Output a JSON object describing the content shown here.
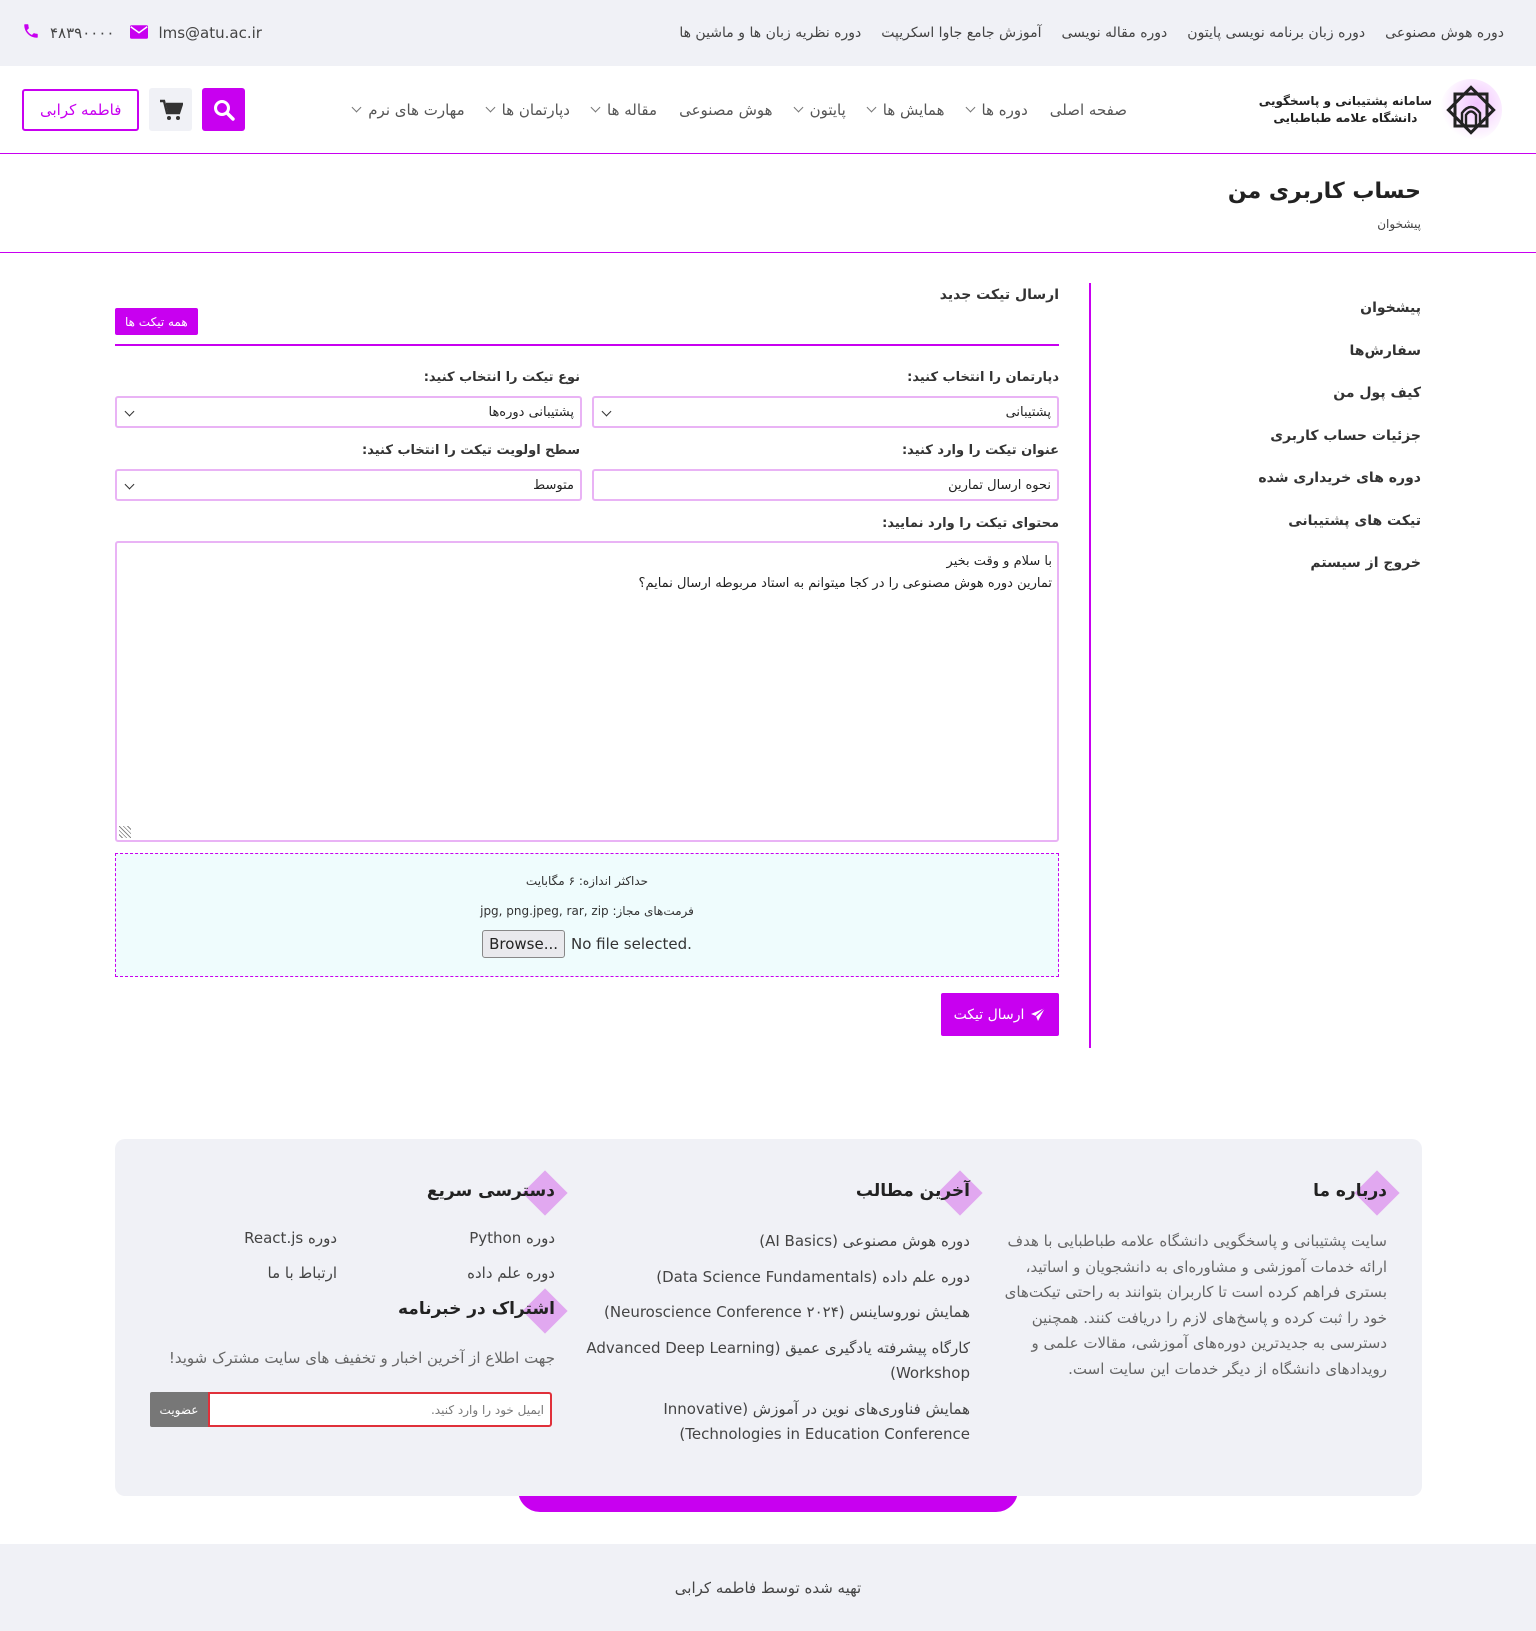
{
  "topbar": {
    "links": [
      "دوره هوش مصنوعی",
      "دوره زبان برنامه نویسی پایتون",
      "دوره مقاله نویسی",
      "آموزش جامع جاوا اسکریپت",
      "دوره نظریه زبان ها و ماشین ها"
    ],
    "email": "lms@atu.ac.ir",
    "phone": "۴۸۳۹۰۰۰۰"
  },
  "brand": {
    "line1": "سامانه پشتیبانی و پاسخگویی",
    "line2": "دانشگاه علامه طباطبایی"
  },
  "nav": [
    {
      "label": "صفحه اصلی",
      "dropdown": false
    },
    {
      "label": "دوره ها",
      "dropdown": true
    },
    {
      "label": "همایش ها",
      "dropdown": true
    },
    {
      "label": "پایتون",
      "dropdown": true
    },
    {
      "label": "هوش مصنوعی",
      "dropdown": false
    },
    {
      "label": "مقاله ها",
      "dropdown": true
    },
    {
      "label": "دپارتمان ها",
      "dropdown": true
    },
    {
      "label": "مهارت های نرم",
      "dropdown": true
    }
  ],
  "header": {
    "user_label": "فاطمه کرابی"
  },
  "page": {
    "title": "حساب کاربری من",
    "breadcrumb": "پیشخوان"
  },
  "sidebar": [
    "پیشخوان",
    "سفارش‌ها",
    "کیف پول من",
    "جزئیات حساب کاربری",
    "دوره های خریداری شده",
    "تیکت های پشتیبانی",
    "خروج از سیستم"
  ],
  "form": {
    "title": "ارسال تیکت جدید",
    "all_tickets": "همه تیکت ها",
    "department_label": "دپارتمان را انتخاب کنید:",
    "department_value": "پشتیبانی",
    "type_label": "نوع تیکت را انتخاب کنید:",
    "type_value": "پشتیبانی دوره‌ها",
    "subject_label": "عنوان تیکت را وارد کنید:",
    "subject_value": "نحوه ارسال تمارین",
    "priority_label": "سطح اولویت تیکت را انتخاب کنید:",
    "priority_value": "متوسط",
    "content_label": "محتوای تیکت را وارد نمایید:",
    "content_line1": "با سلام و وقت بخیر",
    "content_line2": "تمارین دوره هوش مصنوعی را در کجا میتوانم به استاد مربوطه ارسال نمایم؟",
    "max_size": "حداکثر اندازه: ۶ مگابایت",
    "formats": "فرمت‌های مجاز: jpg, png.jpeg, rar, zip",
    "browse": "Browse...",
    "no_file": "No file selected.",
    "send": "ارسال تیکت"
  },
  "footer": {
    "about_title": "درباره ما",
    "about_text": "سایت پشتیبانی و پاسخگویی دانشگاه علامه طباطبایی با هدف ارائه خدمات آموزشی و مشاوره‌ای به دانشجویان و اساتید، بستری فراهم کرده است تا کاربران بتوانند به راحتی تیکت‌های خود را ثبت کرده و پاسخ‌های لازم را دریافت کنند. همچنین دسترسی به جدیدترین دوره‌های آموزشی، مقالات علمی و رویدادهای دانشگاه از دیگر خدمات این سایت است.",
    "latest_title": "آخرین مطالب",
    "latest": [
      "دوره هوش مصنوعی (AI Basics)",
      "دوره علم داده (Data Science Fundamentals)",
      "همایش نوروساینس (Neuroscience Conference ۲۰۲۴)",
      "کارگاه پیشرفته یادگیری عمیق (Advanced Deep Learning Workshop)",
      "همایش فناوری‌های نوین در آموزش (Innovative Technologies in Education Conference)"
    ],
    "quick_title": "دسترسی سریع",
    "quick": [
      "دوره Python",
      "دوره React.js",
      "دوره علم داده",
      "ارتباط با ما"
    ],
    "newsletter_title": "اشتراک در خبرنامه",
    "newsletter_desc": "جهت اطلاع از آخرین اخبار و تخفیف های سایت مشترک شوید!",
    "newsletter_placeholder": "ایمیل خود را وارد کنید.",
    "newsletter_button": "عضویت",
    "copyright": "تهیه شده توسط فاطمه کرابی"
  },
  "colors": {
    "accent": "#c800f0",
    "background_gray": "#f0f1f6",
    "upload_bg": "#effcfd"
  }
}
